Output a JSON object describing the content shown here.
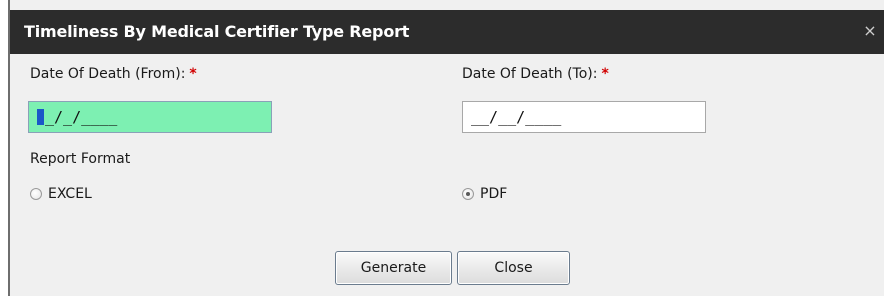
{
  "dialog": {
    "title": "Timeliness By Medical Certifier Type Report",
    "close_label": "×"
  },
  "form": {
    "date_from": {
      "label": "Date Of Death (From):",
      "required_mark": "*",
      "value": "_/_/____"
    },
    "date_to": {
      "label": "Date Of Death (To):",
      "required_mark": "*",
      "value": "__/__/____"
    },
    "report_format": {
      "label": "Report Format",
      "options": [
        {
          "label": "EXCEL",
          "checked": false
        },
        {
          "label": "PDF",
          "checked": true
        }
      ]
    }
  },
  "buttons": {
    "generate_label": "Generate",
    "close_label": "Close"
  },
  "colors": {
    "title_bar": "#2c2c2c",
    "focused_field": "#7df0b2",
    "required": "#d10000",
    "dialog_bg": "#f0f0f0"
  }
}
